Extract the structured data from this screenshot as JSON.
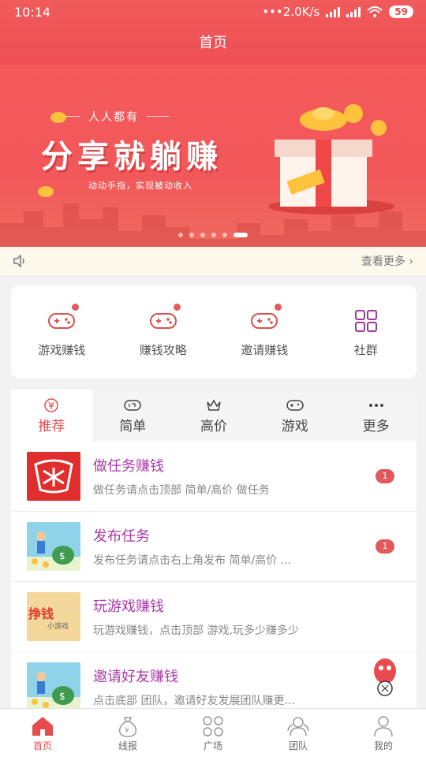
{
  "status": {
    "time": "10:14",
    "speed": "2.0K/s",
    "battery": "59"
  },
  "header": {
    "title": "首页"
  },
  "banner": {
    "small_text": "人人都有",
    "big_text": "分享就躺赚",
    "sub_text": "动动手指，实现被动收入"
  },
  "notice": {
    "more": "查看更多"
  },
  "entries": [
    {
      "label": "游戏赚钱",
      "icon": "gamepad-icon"
    },
    {
      "label": "赚钱攻略",
      "icon": "gamepad-icon"
    },
    {
      "label": "邀请赚钱",
      "icon": "gamepad-icon"
    },
    {
      "label": "社群",
      "icon": "grid-icon"
    }
  ],
  "tabs": [
    {
      "label": "推荐",
      "icon": "yen-icon",
      "active": true
    },
    {
      "label": "简单",
      "icon": "tag-icon"
    },
    {
      "label": "高价",
      "icon": "crown-icon"
    },
    {
      "label": "游戏",
      "icon": "gamepad-icon"
    },
    {
      "label": "更多",
      "icon": "more-dots-icon"
    }
  ],
  "tasks": [
    {
      "title": "做任务赚钱",
      "desc": "做任务请点击顶部 简单/高价 做任务",
      "count": "1"
    },
    {
      "title": "发布任务",
      "desc": "发布任务请点击右上角发布 简单/高价 ...",
      "count": "1"
    },
    {
      "title": "玩游戏赚钱",
      "desc": "玩游戏赚钱，点击顶部 游戏,玩多少赚多少",
      "thumb_text": "挣钱",
      "thumb_sub": "小游戏"
    },
    {
      "title": "邀请好友赚钱",
      "desc": "点击底部 团队，邀请好友发展团队赚更..."
    }
  ],
  "nav": [
    {
      "label": "首页",
      "icon": "home-icon",
      "active": true
    },
    {
      "label": "线报",
      "icon": "money-bag-icon"
    },
    {
      "label": "广场",
      "icon": "grid-icon"
    },
    {
      "label": "团队",
      "icon": "team-icon"
    },
    {
      "label": "我的",
      "icon": "user-icon"
    }
  ],
  "colors": {
    "primary": "#ee4f55",
    "title_purple": "#a83aa8"
  }
}
